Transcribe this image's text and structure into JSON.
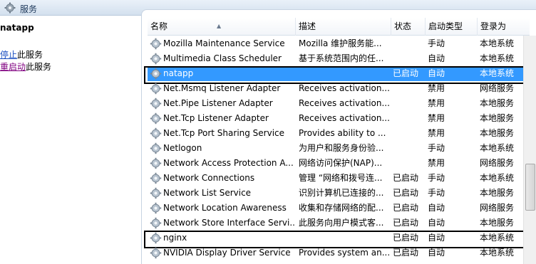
{
  "window": {
    "title": "服务"
  },
  "left": {
    "service_name": "natapp",
    "stop_link": "停止",
    "stop_suffix": "此服务",
    "restart_link": "重启动",
    "restart_suffix": "此服务"
  },
  "columns": {
    "name": "名称",
    "description": "描述",
    "status": "状态",
    "startup": "启动类型",
    "logon": "登录为"
  },
  "services": [
    {
      "name": "Mozilla Maintenance Service",
      "description": "Mozilla 维护服务能...",
      "status": "",
      "startup": "手动",
      "logon": "本地系统"
    },
    {
      "name": "Multimedia Class Scheduler",
      "description": "基于系统范围内的任...",
      "status": "",
      "startup": "自动",
      "logon": "本地系统"
    },
    {
      "name": "natapp",
      "description": "",
      "status": "已启动",
      "startup": "自动",
      "logon": "本地系统"
    },
    {
      "name": "Net.Msmq Listener Adapter",
      "description": "Receives activation...",
      "status": "",
      "startup": "禁用",
      "logon": "网络服务"
    },
    {
      "name": "Net.Pipe Listener Adapter",
      "description": "Receives activation...",
      "status": "",
      "startup": "禁用",
      "logon": "本地服务"
    },
    {
      "name": "Net.Tcp Listener Adapter",
      "description": "Receives activation...",
      "status": "",
      "startup": "禁用",
      "logon": "本地服务"
    },
    {
      "name": "Net.Tcp Port Sharing Service",
      "description": "Provides ability to ...",
      "status": "",
      "startup": "禁用",
      "logon": "本地服务"
    },
    {
      "name": "Netlogon",
      "description": "为用户和服务身份验...",
      "status": "",
      "startup": "手动",
      "logon": "本地系统"
    },
    {
      "name": "Network Access Protection A...",
      "description": "网络访问保护(NAP)...",
      "status": "",
      "startup": "禁用",
      "logon": "网络服务"
    },
    {
      "name": "Network Connections",
      "description": "管理 “网络和拨号连...",
      "status": "已启动",
      "startup": "手动",
      "logon": "本地系统"
    },
    {
      "name": "Network List Service",
      "description": "识别计算机已连接的...",
      "status": "已启动",
      "startup": "手动",
      "logon": "本地服务"
    },
    {
      "name": "Network Location Awareness",
      "description": "收集和存储网络的配...",
      "status": "已启动",
      "startup": "自动",
      "logon": "网络服务"
    },
    {
      "name": "Network Store Interface Servi...",
      "description": "此服务向用户模式客...",
      "status": "已启动",
      "startup": "自动",
      "logon": "本地服务"
    },
    {
      "name": "nginx",
      "description": "",
      "status": "已启动",
      "startup": "自动",
      "logon": "本地系统"
    },
    {
      "name": "NVIDIA Display Driver Service",
      "description": "Provides system an...",
      "status": "已启动",
      "startup": "自动",
      "logon": "本地系统"
    }
  ],
  "selected_service": "natapp",
  "boxed_services": [
    "natapp",
    "nginx"
  ],
  "colors": {
    "selection": "#3399ff",
    "link": "#1a4ec0",
    "visited_link": "#800080"
  }
}
